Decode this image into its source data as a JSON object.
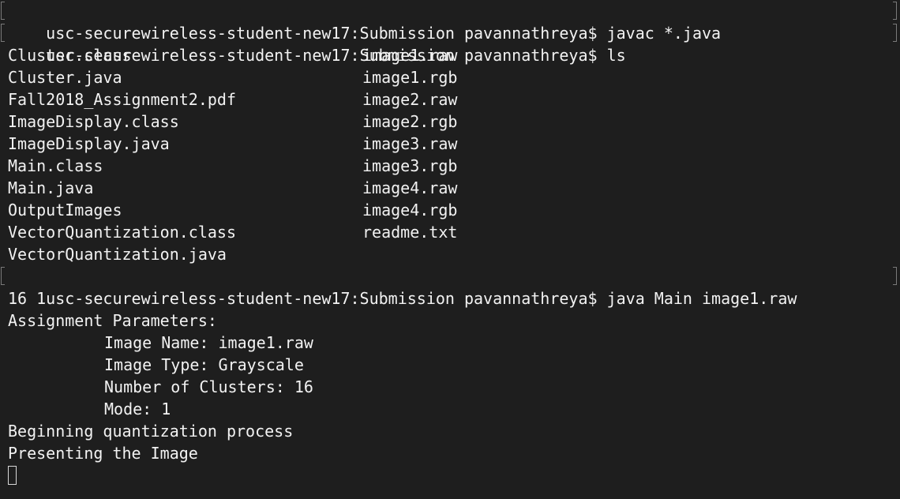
{
  "terminal": {
    "commands": [
      {
        "prompt": "usc-securewireless-student-new17:Submission pavannathreya$ ",
        "input": "javac *.java"
      },
      {
        "prompt": "usc-securewireless-student-new17:Submission pavannathreya$ ",
        "input": "ls"
      },
      {
        "prompt": "usc-securewireless-student-new17:Submission pavannathreya$ ",
        "input": "java Main image1.raw"
      }
    ],
    "ls_listing": {
      "left": [
        "Cluster.class",
        "Cluster.java",
        "Fall2018_Assignment2.pdf",
        "ImageDisplay.class",
        "ImageDisplay.java",
        "Main.class",
        "Main.java",
        "OutputImages",
        "VectorQuantization.class",
        "VectorQuantization.java"
      ],
      "right": [
        "image1.raw",
        "image1.rgb",
        "image2.raw",
        "image2.rgb",
        "image3.raw",
        "image3.rgb",
        "image4.raw",
        "image4.rgb",
        "readme.txt"
      ]
    },
    "output": {
      "line_args": "16 1",
      "params_header": "Assignment Parameters:",
      "params": [
        "Image Name: image1.raw",
        "Image Type: Grayscale",
        "Number of Clusters: 16",
        "Mode: 1"
      ],
      "status_1": "Beginning quantization process",
      "status_2": "Presenting the Image"
    }
  },
  "colors": {
    "background": "#1e1e1e",
    "foreground": "#f2f2f2"
  }
}
